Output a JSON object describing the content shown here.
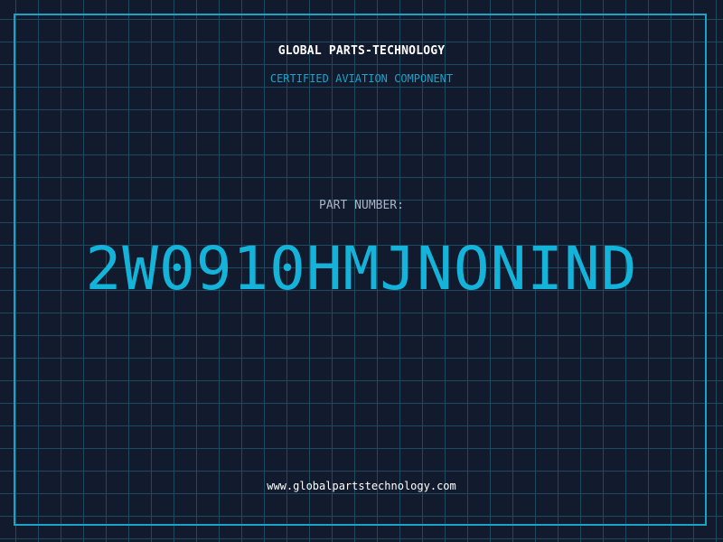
{
  "brand": {
    "title": "GLOBAL PARTS-TECHNOLOGY",
    "subtitle": "CERTIFIED AVIATION COMPONENT"
  },
  "part": {
    "label": "PART NUMBER:",
    "number": "2W0910HMJNONIND"
  },
  "footer": {
    "website": "www.globalpartstechnology.com"
  },
  "colors": {
    "background": "#121a2e",
    "grid": "#1d4a5e",
    "accent": "#1aa3c7",
    "part_number": "#14b3d9",
    "label": "#a9b4c8",
    "text": "#ffffff"
  }
}
